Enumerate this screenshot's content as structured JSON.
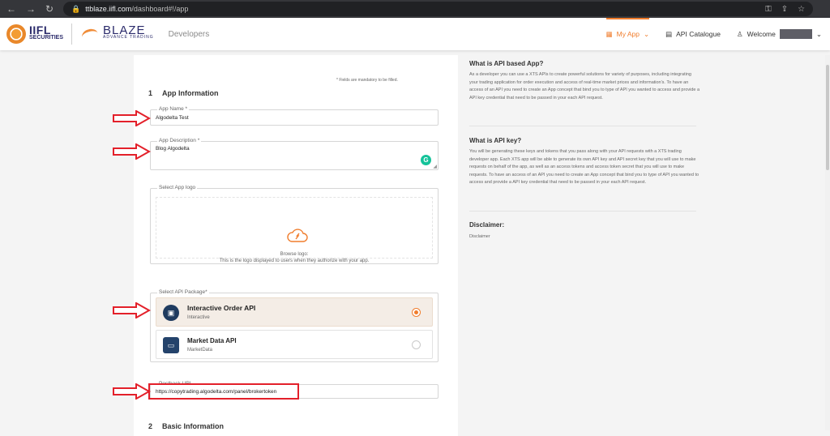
{
  "browser": {
    "url_prefix": "ttblaze.iifl.com",
    "url_path": "/dashboard#!/app"
  },
  "header": {
    "iifl_logo": "IIFL",
    "iifl_sub": "SECURITIES",
    "blaze_logo": "BLAZE",
    "blaze_sub": "ADVANCE TRADING",
    "developers": "Developers",
    "my_app": "My App",
    "api_catalogue": "API Catalogue",
    "welcome": "Welcome",
    "colors": {
      "accent": "#f07d2d",
      "brand_navy": "#2b2b6b"
    }
  },
  "form": {
    "mandatory_note": "* Fields are mandatory to be filled.",
    "section1_num": "1",
    "section1_title": "App Information",
    "app_name_label": "App Name *",
    "app_name_value": "Algodelta Test",
    "app_desc_label": "App Description *",
    "app_desc_value": "Blog Algodelta",
    "logo_label": "Select App logo",
    "browse_logo": "Browse logo:",
    "logo_hint": "This is the logo displayed to users when they authorize with your app.",
    "package_label": "Select API Package*",
    "packages": [
      {
        "title": "Interactive Order API",
        "sub": "Interactive",
        "selected": true,
        "icon": "user-card-icon"
      },
      {
        "title": "Market Data API",
        "sub": "MarketData",
        "selected": false,
        "icon": "monitor-icon"
      }
    ],
    "postback_label": "Postback URL",
    "postback_value": "https://copytrading.algodelta.com/panel/brokertoken",
    "section2_num": "2",
    "section2_title": "Basic Information"
  },
  "info": {
    "h1": "What is API based App?",
    "p1": "As a developer you can use a XTS APIs to create powerful solutions for variety of purposes, including integrating your trading application for order execution and access of real-time market prices and information's. To have an access of an API you need to create an App concept that bind you to type of API you wanted to access and provide a API key credential that need to be passed in your each API request.",
    "h2": "What is API key?",
    "p2": "You will be generating these keys and tokens that you pass along with your API requests with a XTS trading developer app. Each XTS app will be able to generate its own API key and API secret key that you will use to make requests on behalf of the app, as well as an access tokens and access token secret that you will use to make requests. To have an access of an API you need to create an App concept that bind you to type of API you wanted to access and provide a API key credential that need to be passed in your each API request.",
    "h3": "Disclaimer:",
    "p3": "Disclaimer"
  }
}
